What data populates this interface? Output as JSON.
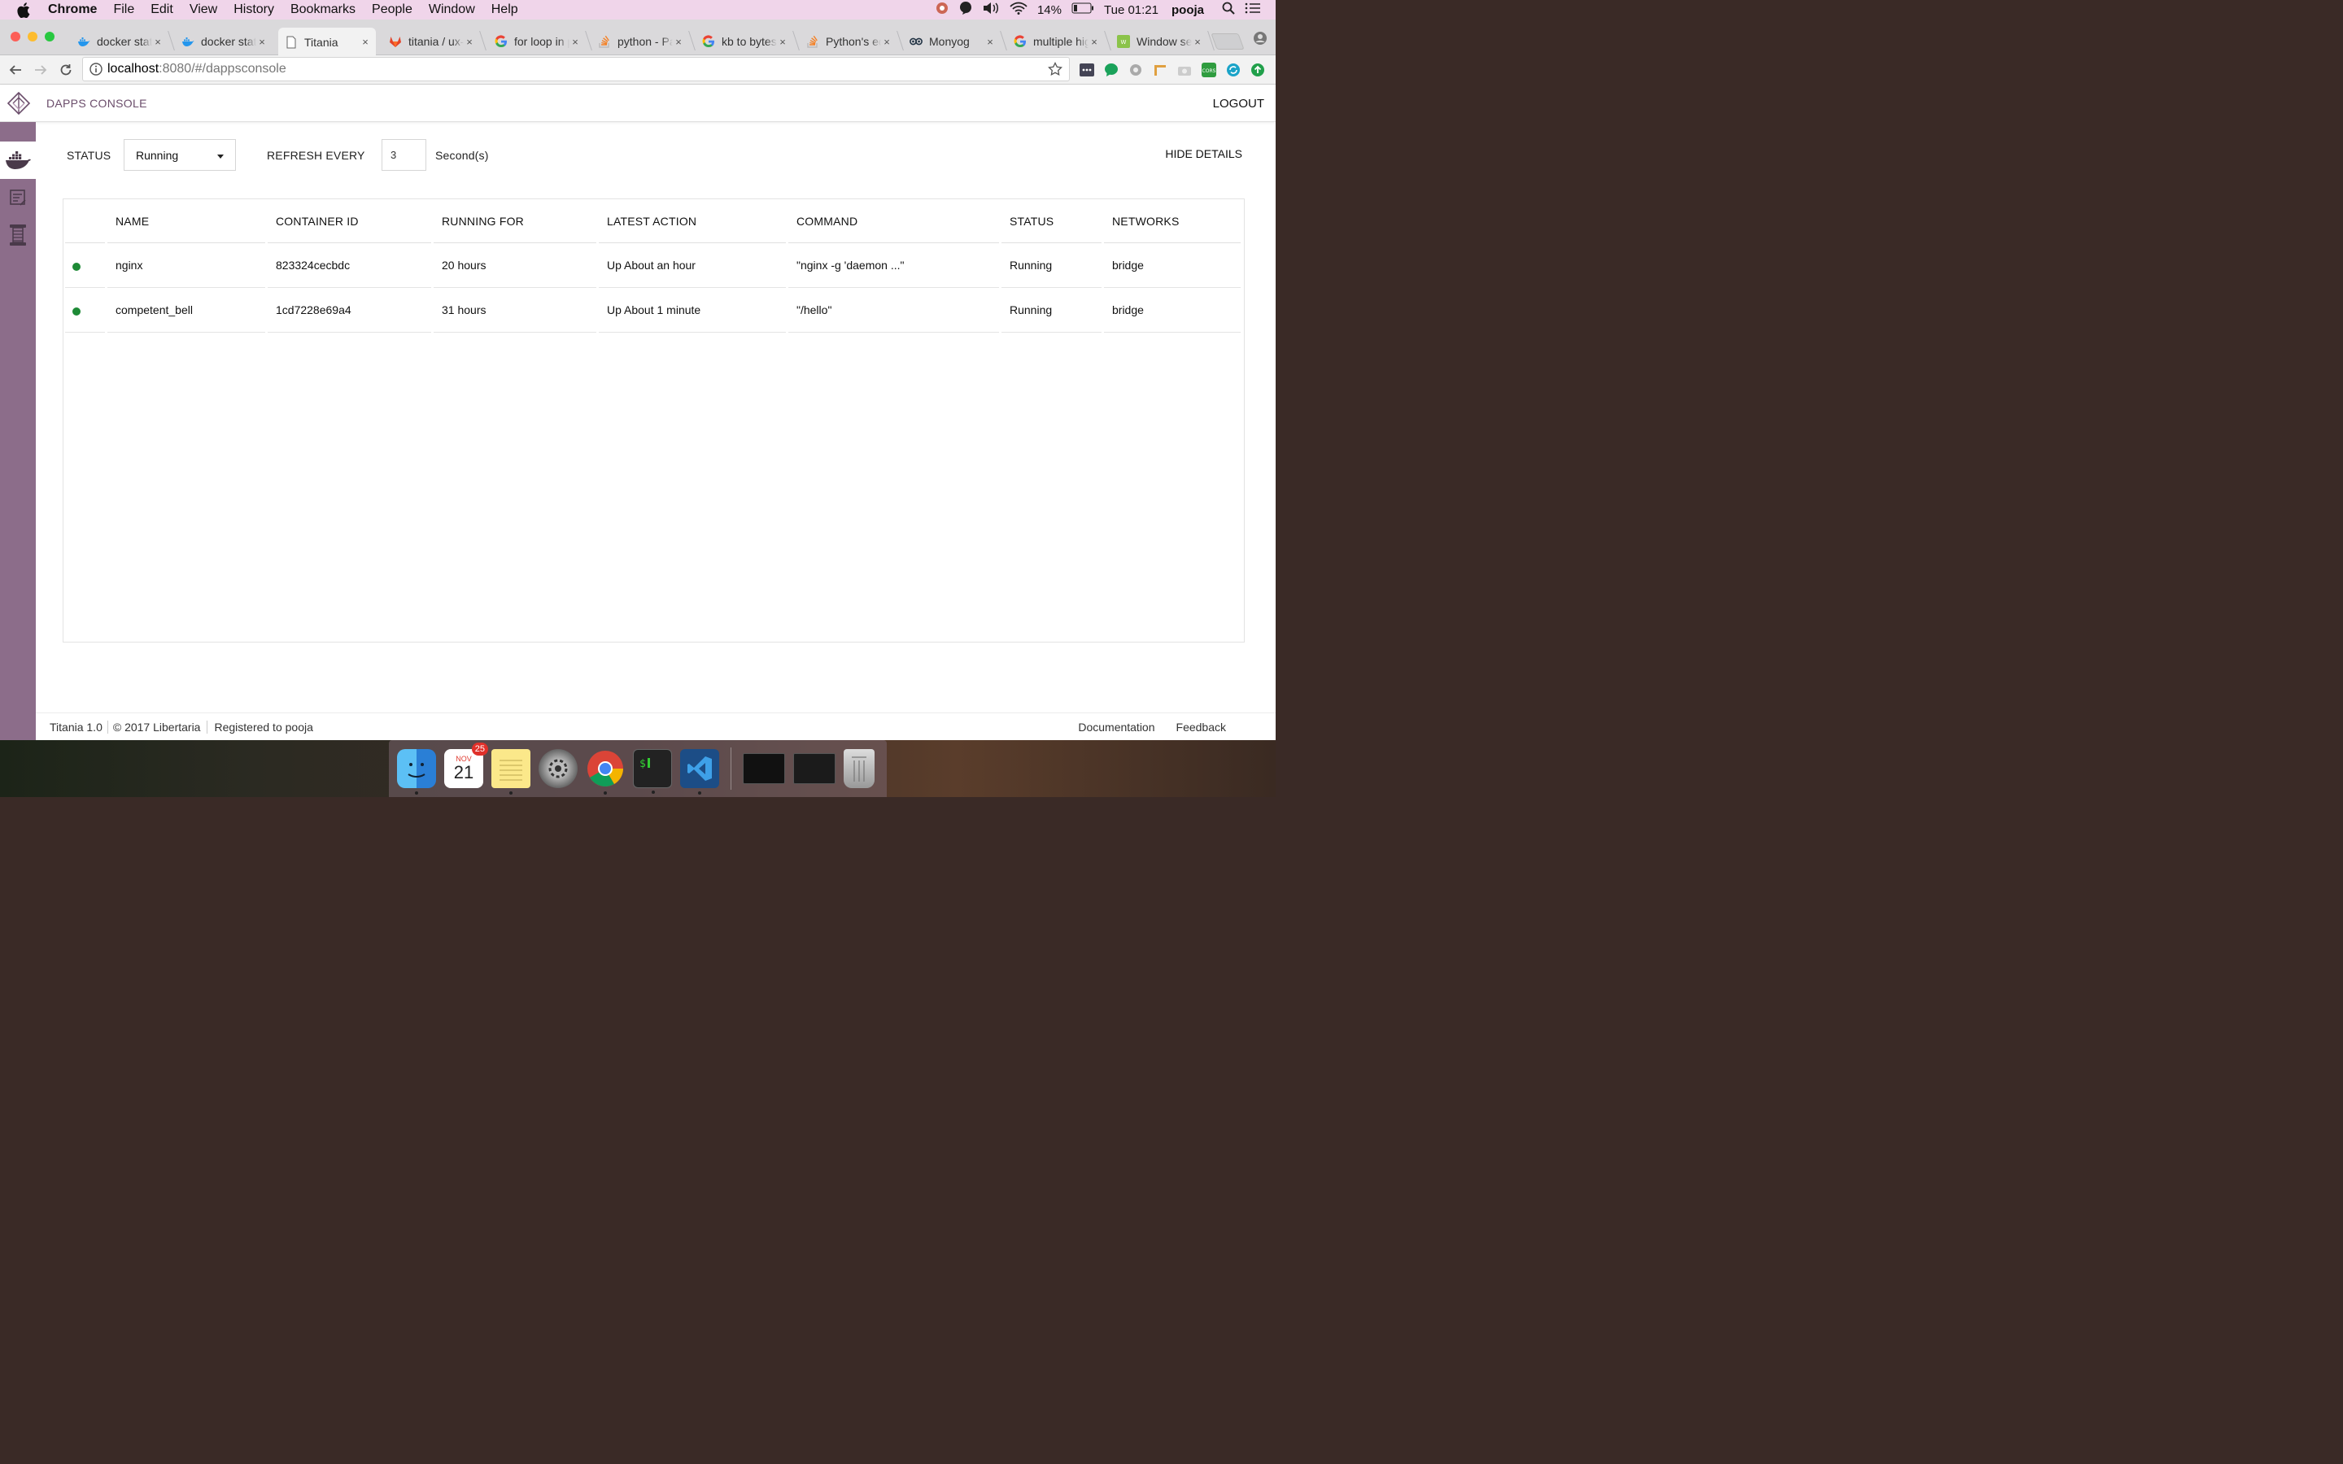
{
  "menubar": {
    "app": "Chrome",
    "items": [
      "File",
      "Edit",
      "View",
      "History",
      "Bookmarks",
      "People",
      "Window",
      "Help"
    ],
    "battery": "14%",
    "clock": "Tue 01:21",
    "user": "pooja"
  },
  "tabs": [
    {
      "title": "docker stats",
      "icon": "docker-icon"
    },
    {
      "title": "docker stats",
      "icon": "docker-icon"
    },
    {
      "title": "Titania",
      "icon": "page-icon"
    },
    {
      "title": "titania / ux-",
      "icon": "gitlab-icon"
    },
    {
      "title": "for loop in python",
      "icon": "google-icon"
    },
    {
      "title": "python - Pa",
      "icon": "stackoverflow-icon"
    },
    {
      "title": "kb to bytes",
      "icon": "google-icon"
    },
    {
      "title": "Python's ed",
      "icon": "stackoverflow-icon"
    },
    {
      "title": "Monyog",
      "icon": "monyog-icon"
    },
    {
      "title": "multiple high",
      "icon": "google-icon"
    },
    {
      "title": "Window set",
      "icon": "webdev-icon"
    }
  ],
  "address": {
    "host": "localhost",
    "path": ":8080/#/dappsconsole"
  },
  "app": {
    "title": "DAPPS CONSOLE",
    "logout": "LOGOUT"
  },
  "controls": {
    "status_label": "STATUS",
    "status_value": "Running",
    "refresh_label": "REFRESH EVERY",
    "refresh_value": "3",
    "seconds_label": "Second(s)",
    "hide_details": "HIDE DETAILS"
  },
  "table": {
    "headers": [
      "",
      "NAME",
      "CONTAINER ID",
      "RUNNING FOR",
      "LATEST ACTION",
      "COMMAND",
      "STATUS",
      "NETWORKS"
    ],
    "rows": [
      {
        "name": "nginx",
        "id": "823324cecbdc",
        "running_for": "20 hours",
        "latest_action": "Up About an hour",
        "command": "\"nginx -g 'daemon ...\"",
        "status": "Running",
        "networks": "bridge"
      },
      {
        "name": "competent_bell",
        "id": "1cd7228e69a4",
        "running_for": "31 hours",
        "latest_action": "Up About 1 minute",
        "command": "\"/hello\"",
        "status": "Running",
        "networks": "bridge"
      }
    ]
  },
  "footer": {
    "product": "Titania 1.0",
    "copyright": "©  2017 Libertaria",
    "registered": "Registered to pooja",
    "documentation": "Documentation",
    "feedback": "Feedback"
  },
  "dock": {
    "calendar_month": "NOV",
    "calendar_day": "21",
    "calendar_badge": "25"
  },
  "colors": {
    "sidebar": "#8c6d8a",
    "status_running": "#1e8a36",
    "title": "#6b4d6b"
  }
}
